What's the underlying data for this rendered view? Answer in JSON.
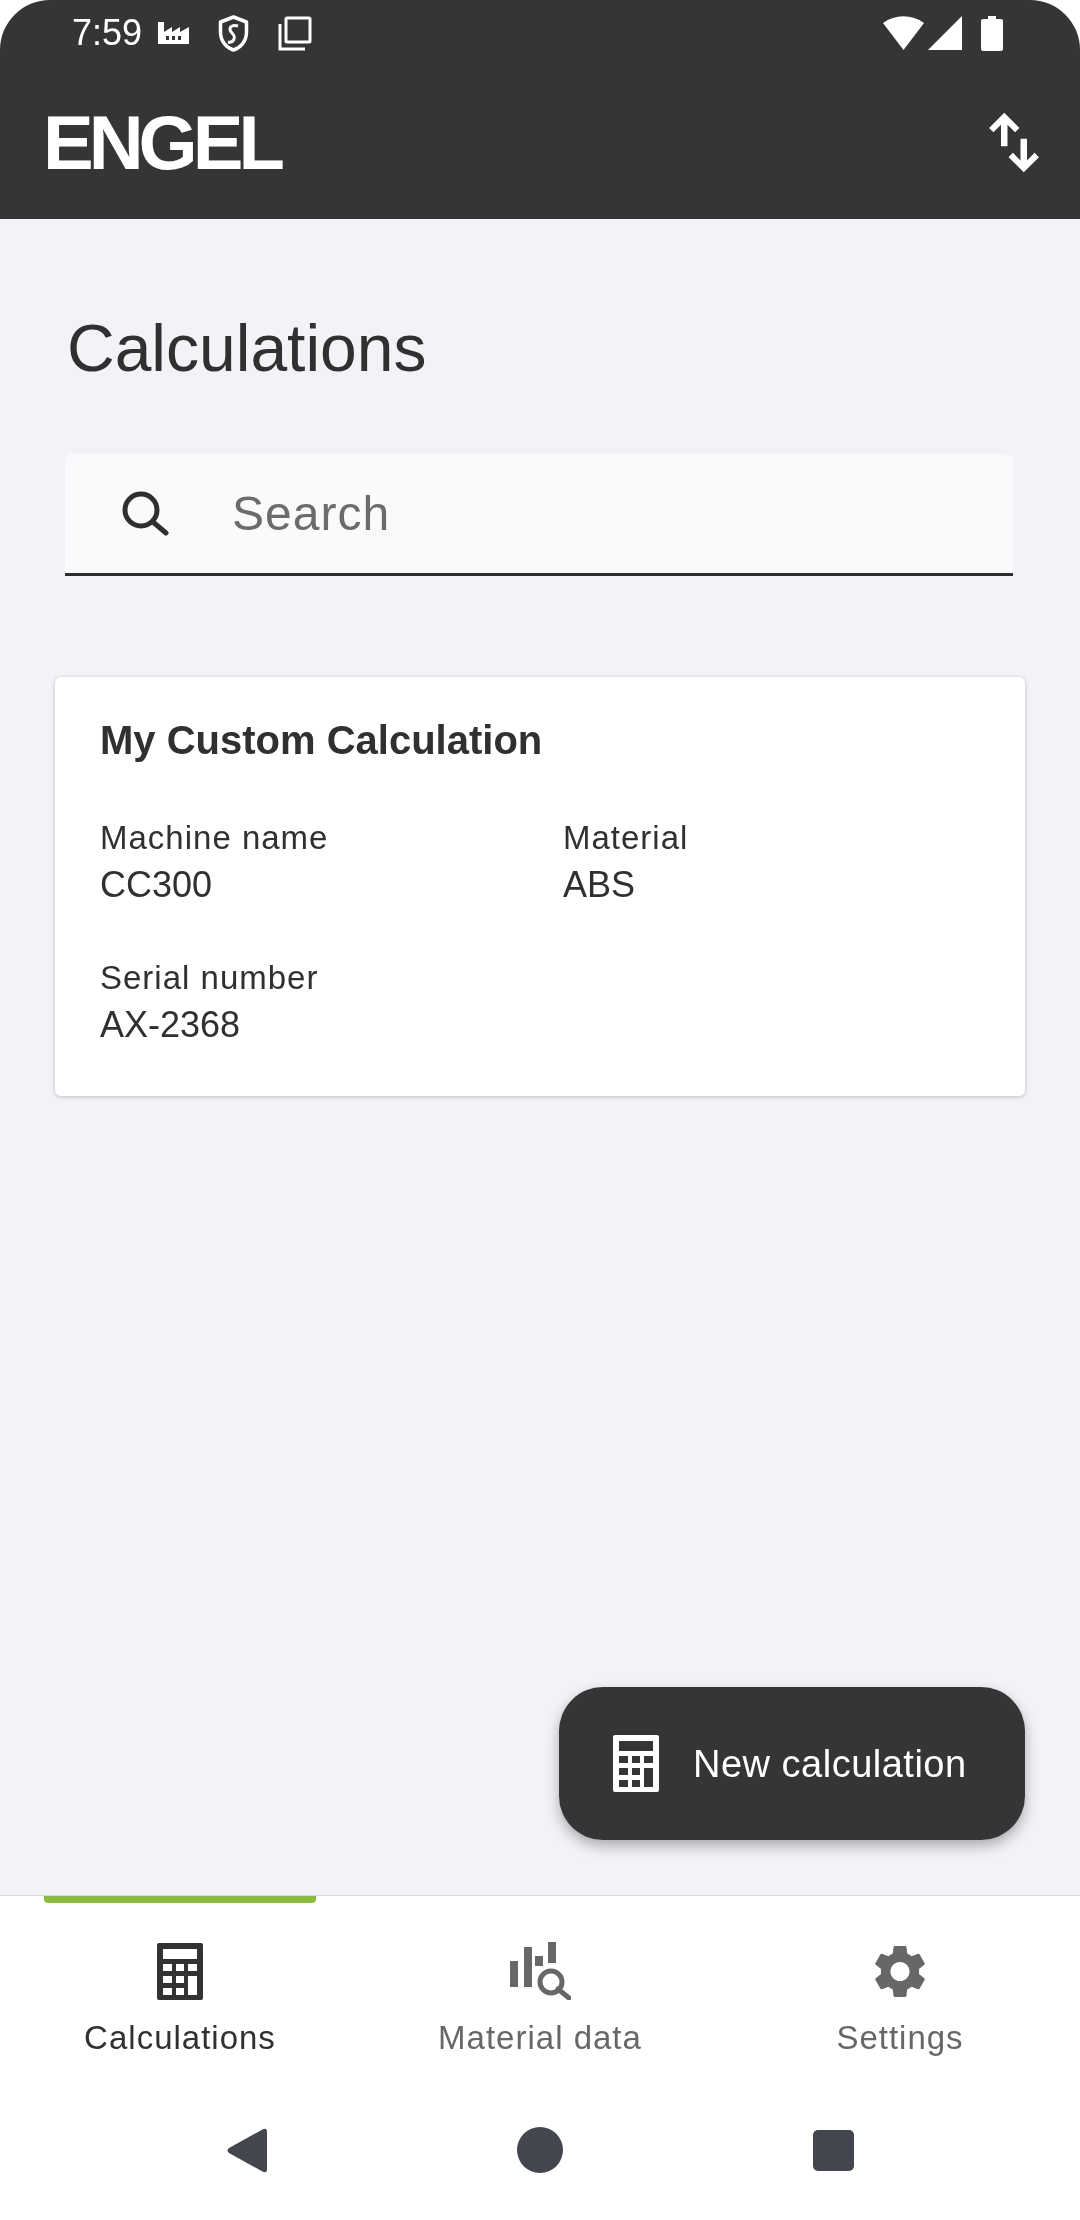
{
  "status_bar": {
    "time": "7:59"
  },
  "app_bar": {
    "logo": "ENGEL"
  },
  "page": {
    "title": "Calculations"
  },
  "search": {
    "placeholder": "Search"
  },
  "calculations": [
    {
      "title": "My Custom Calculation",
      "fields": [
        {
          "label": "Machine name",
          "value": "CC300"
        },
        {
          "label": "Material",
          "value": "ABS"
        },
        {
          "label": "Serial number",
          "value": "AX-2368"
        }
      ]
    }
  ],
  "fab": {
    "label": "New calculation"
  },
  "bottom_nav": [
    {
      "label": "Calculations",
      "selected": true
    },
    {
      "label": "Material data",
      "selected": false
    },
    {
      "label": "Settings",
      "selected": false
    }
  ]
}
